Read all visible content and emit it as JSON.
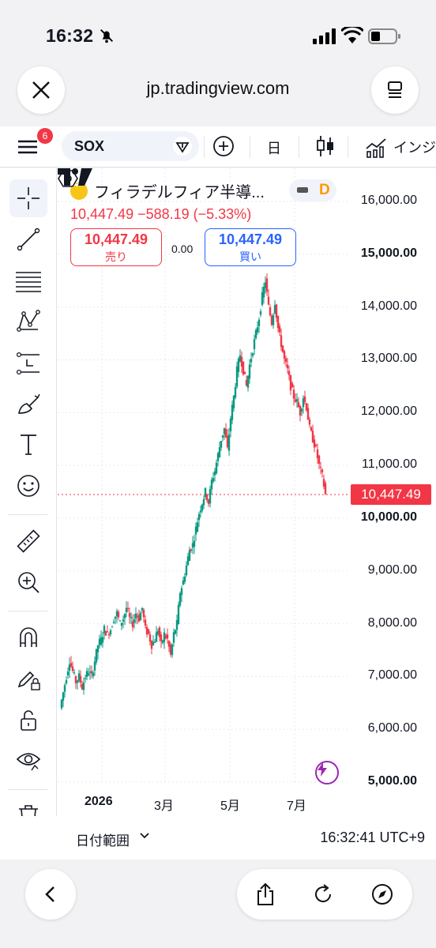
{
  "status_bar": {
    "time": "16:32"
  },
  "browser": {
    "url": "jp.tradingview.com"
  },
  "toolbar": {
    "notification_count": "6",
    "symbol": "SOX",
    "interval": "日",
    "indicators_label": "インジ"
  },
  "legend": {
    "name": "フィラデルフィア半導...",
    "source_badge": "D",
    "ohlc_line": "10,447.49 −588.19 (−5.33%)",
    "sell_price": "10,447.49",
    "sell_label": "売り",
    "spread": "0.00",
    "buy_price": "10,447.49",
    "buy_label": "買い"
  },
  "chart_data": {
    "type": "candlestick",
    "symbol": "SOX",
    "ylim": [
      5000,
      16000
    ],
    "y_ticks": [
      "16,000.00",
      "15,000.00",
      "14,000.00",
      "13,000.00",
      "12,000.00",
      "11,000.00",
      "10,000.00",
      "9,000.00",
      "8,000.00",
      "7,000.00",
      "6,000.00",
      "5,000.00"
    ],
    "x_ticks": [
      "2026",
      "3月",
      "5月",
      "7月"
    ],
    "last_price": "10,447.49",
    "close_path": [
      [
        0,
        6400
      ],
      [
        4,
        6700
      ],
      [
        8,
        7000
      ],
      [
        12,
        7300
      ],
      [
        16,
        7100
      ],
      [
        20,
        6900
      ],
      [
        24,
        7000
      ],
      [
        28,
        6800
      ],
      [
        32,
        7000
      ],
      [
        36,
        7100
      ],
      [
        40,
        7000
      ],
      [
        44,
        7300
      ],
      [
        48,
        7600
      ],
      [
        52,
        7700
      ],
      [
        56,
        7900
      ],
      [
        60,
        7800
      ],
      [
        64,
        7900
      ],
      [
        68,
        8100
      ],
      [
        72,
        8200
      ],
      [
        76,
        8000
      ],
      [
        80,
        8100
      ],
      [
        84,
        8300
      ],
      [
        88,
        8100
      ],
      [
        92,
        8000
      ],
      [
        96,
        8200
      ],
      [
        100,
        8100
      ],
      [
        104,
        8300
      ],
      [
        108,
        7900
      ],
      [
        112,
        7800
      ],
      [
        116,
        7600
      ],
      [
        120,
        7700
      ],
      [
        124,
        7900
      ],
      [
        128,
        7600
      ],
      [
        132,
        7800
      ],
      [
        136,
        7700
      ],
      [
        140,
        7400
      ],
      [
        144,
        7800
      ],
      [
        148,
        8000
      ],
      [
        152,
        8600
      ],
      [
        156,
        8800
      ],
      [
        160,
        9100
      ],
      [
        164,
        9400
      ],
      [
        168,
        9500
      ],
      [
        172,
        9800
      ],
      [
        176,
        10100
      ],
      [
        180,
        10300
      ],
      [
        184,
        10500
      ],
      [
        188,
        10300
      ],
      [
        192,
        10700
      ],
      [
        196,
        10900
      ],
      [
        200,
        11200
      ],
      [
        204,
        11500
      ],
      [
        208,
        11700
      ],
      [
        212,
        11300
      ],
      [
        216,
        11900
      ],
      [
        220,
        12300
      ],
      [
        224,
        12800
      ],
      [
        228,
        13100
      ],
      [
        232,
        12800
      ],
      [
        236,
        12500
      ],
      [
        240,
        12900
      ],
      [
        244,
        13200
      ],
      [
        248,
        13500
      ],
      [
        252,
        13800
      ],
      [
        256,
        14200
      ],
      [
        260,
        14500
      ],
      [
        264,
        14000
      ],
      [
        268,
        13700
      ],
      [
        272,
        14100
      ],
      [
        276,
        13600
      ],
      [
        280,
        13300
      ],
      [
        284,
        13000
      ],
      [
        288,
        12800
      ],
      [
        292,
        12500
      ],
      [
        296,
        12300
      ],
      [
        300,
        12200
      ],
      [
        304,
        12000
      ],
      [
        308,
        12300
      ],
      [
        312,
        12100
      ],
      [
        316,
        11700
      ],
      [
        320,
        11500
      ],
      [
        324,
        11300
      ],
      [
        328,
        11000
      ],
      [
        332,
        10800
      ],
      [
        336,
        10447.49
      ]
    ]
  },
  "axis": {
    "last_price_tag": "10,447.49"
  },
  "bottom": {
    "date_range": "日付範囲",
    "clock": "16:32:41 UTC+9"
  }
}
